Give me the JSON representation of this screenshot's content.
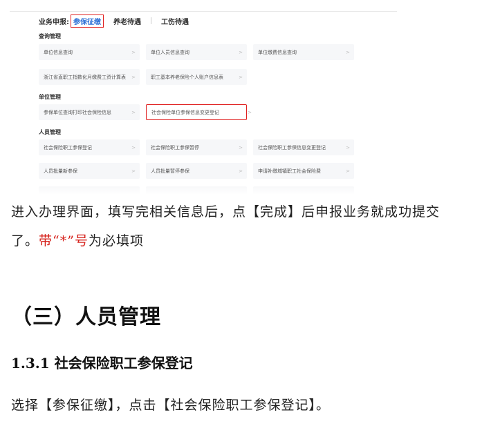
{
  "screenshot": {
    "tab_prefix": "业务申报:",
    "tabs": [
      {
        "label": "参保征缴",
        "active": true
      },
      {
        "label": "养老待遇",
        "active": false
      },
      {
        "label": "工伤待遇",
        "active": false
      }
    ],
    "sections": [
      {
        "title": "查询管理",
        "items": [
          "单位信息查询",
          "单位人员信息查询",
          "单位缴费信息查询",
          "浙江省直职工指数化月缴费工资计算表",
          "职工基本养老保险个人账户信息表"
        ]
      },
      {
        "title": "单位管理",
        "items": [
          "参保单位查询打印社会保险信息",
          "社会保险单位参保信息变更登记"
        ]
      },
      {
        "title": "人员管理",
        "items": [
          "社会保险职工参保登记",
          "社会保险职工参保暂停",
          "社会保险职工参保信息变更登记",
          "人员批量新参保",
          "人员批量暂停参保",
          "申请补缴城镇职工社会保险费"
        ]
      }
    ],
    "chevron": ">",
    "highlight_color": "#e02020",
    "active_tab_color": "#2b6fd6"
  },
  "document": {
    "para1_line1": "进入办理界面，填写完相关信息后，点【完成】后申报业务就成功提交",
    "para1_line2_a": "了。",
    "para1_line2_red": "带“*”号",
    "para1_line2_b": "为必填项",
    "heading2": "（三）人员管理",
    "heading3": "1.3.1 社会保险职工参保登记",
    "para2": "选择【参保征缴】，点击【社会保险职工参保登记】。",
    "accent_red": "#d6211b"
  }
}
